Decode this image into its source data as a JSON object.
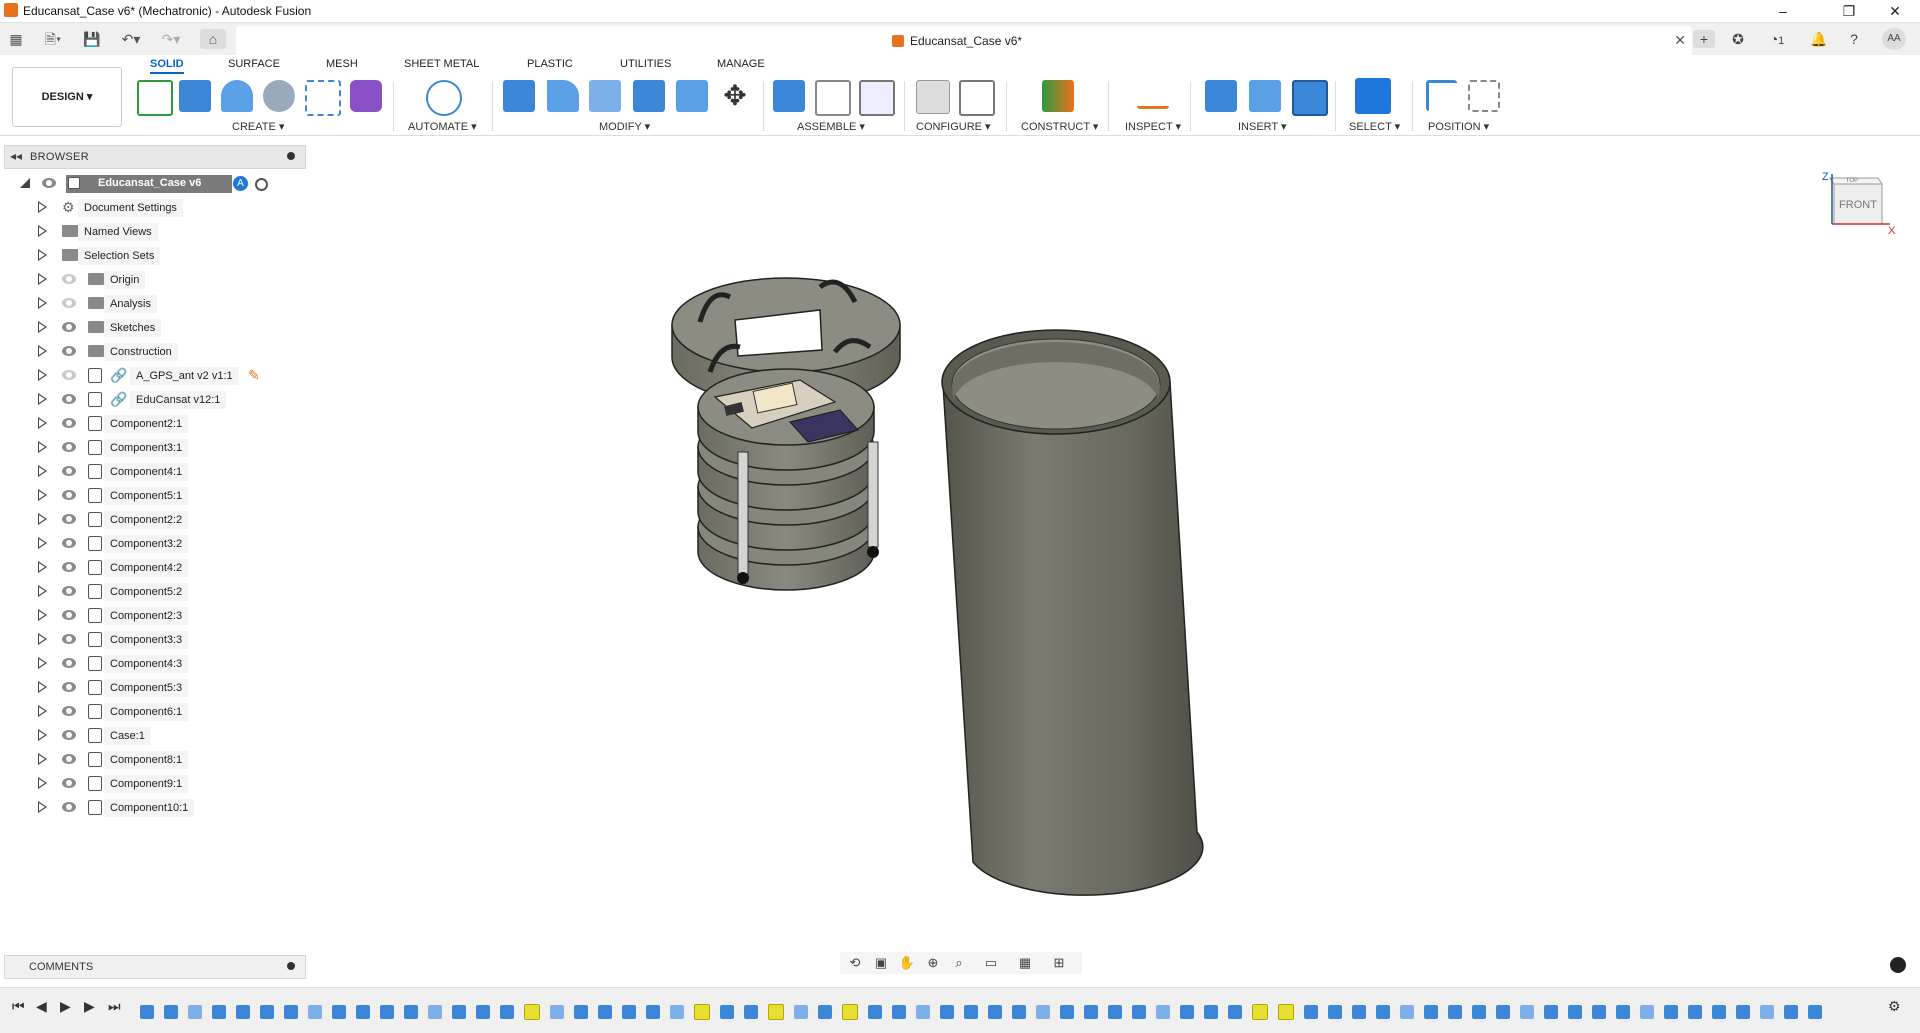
{
  "window": {
    "title": "Educansat_Case v6* (Mechatronic) - Autodesk Fusion",
    "controls": [
      "–",
      "❐",
      "✕"
    ]
  },
  "quickbar": {
    "document_tab": "Educansat_Case v6*",
    "notifications_count": "1",
    "user_initials": "AA"
  },
  "ribbon": {
    "workspace": "DESIGN",
    "tabs": [
      "SOLID",
      "SURFACE",
      "MESH",
      "SHEET METAL",
      "PLASTIC",
      "UTILITIES",
      "MANAGE"
    ],
    "groups": [
      "CREATE",
      "AUTOMATE",
      "MODIFY",
      "ASSEMBLE",
      "CONFIGURE",
      "CONSTRUCT",
      "INSPECT",
      "INSERT",
      "SELECT",
      "POSITION"
    ]
  },
  "browser": {
    "title": "BROWSER",
    "root": "Educansat_Case v6",
    "items": [
      {
        "label": "Document Settings",
        "icon": "gear",
        "eye": "none"
      },
      {
        "label": "Named Views",
        "icon": "folder",
        "eye": "none"
      },
      {
        "label": "Selection Sets",
        "icon": "folder",
        "eye": "none"
      },
      {
        "label": "Origin",
        "icon": "folder",
        "eye": "hidden"
      },
      {
        "label": "Analysis",
        "icon": "folder",
        "eye": "hidden"
      },
      {
        "label": "Sketches",
        "icon": "folder",
        "eye": "visible"
      },
      {
        "label": "Construction",
        "icon": "folder",
        "eye": "visible"
      },
      {
        "label": "A_GPS_ant v2 v1:1",
        "icon": "link",
        "eye": "hidden"
      },
      {
        "label": "EduCansat v12:1",
        "icon": "link",
        "eye": "visible"
      },
      {
        "label": "Component2:1",
        "icon": "component",
        "eye": "visible"
      },
      {
        "label": "Component3:1",
        "icon": "component",
        "eye": "visible"
      },
      {
        "label": "Component4:1",
        "icon": "component",
        "eye": "visible"
      },
      {
        "label": "Component5:1",
        "icon": "component",
        "eye": "visible"
      },
      {
        "label": "Component2:2",
        "icon": "component",
        "eye": "visible"
      },
      {
        "label": "Component3:2",
        "icon": "component",
        "eye": "visible"
      },
      {
        "label": "Component4:2",
        "icon": "component",
        "eye": "visible"
      },
      {
        "label": "Component5:2",
        "icon": "component",
        "eye": "visible"
      },
      {
        "label": "Component2:3",
        "icon": "component",
        "eye": "visible"
      },
      {
        "label": "Component3:3",
        "icon": "component",
        "eye": "visible"
      },
      {
        "label": "Component4:3",
        "icon": "component",
        "eye": "visible"
      },
      {
        "label": "Component5:3",
        "icon": "component",
        "eye": "visible"
      },
      {
        "label": "Component6:1",
        "icon": "component",
        "eye": "visible"
      },
      {
        "label": "Case:1",
        "icon": "component",
        "eye": "visible"
      },
      {
        "label": "Component8:1",
        "icon": "component",
        "eye": "visible"
      },
      {
        "label": "Component9:1",
        "icon": "component",
        "eye": "visible"
      },
      {
        "label": "Component10:1",
        "icon": "component",
        "eye": "visible"
      }
    ]
  },
  "comments": {
    "title": "COMMENTS"
  },
  "viewcube": {
    "top": "TOP",
    "front": "FRONT",
    "axis_x": "X",
    "axis_z": "Z"
  },
  "colors": {
    "accent": "#0a64c8",
    "model": "#6b6b60",
    "timeline_feature": "#3d87d8",
    "timeline_highlight": "#e7e033"
  }
}
